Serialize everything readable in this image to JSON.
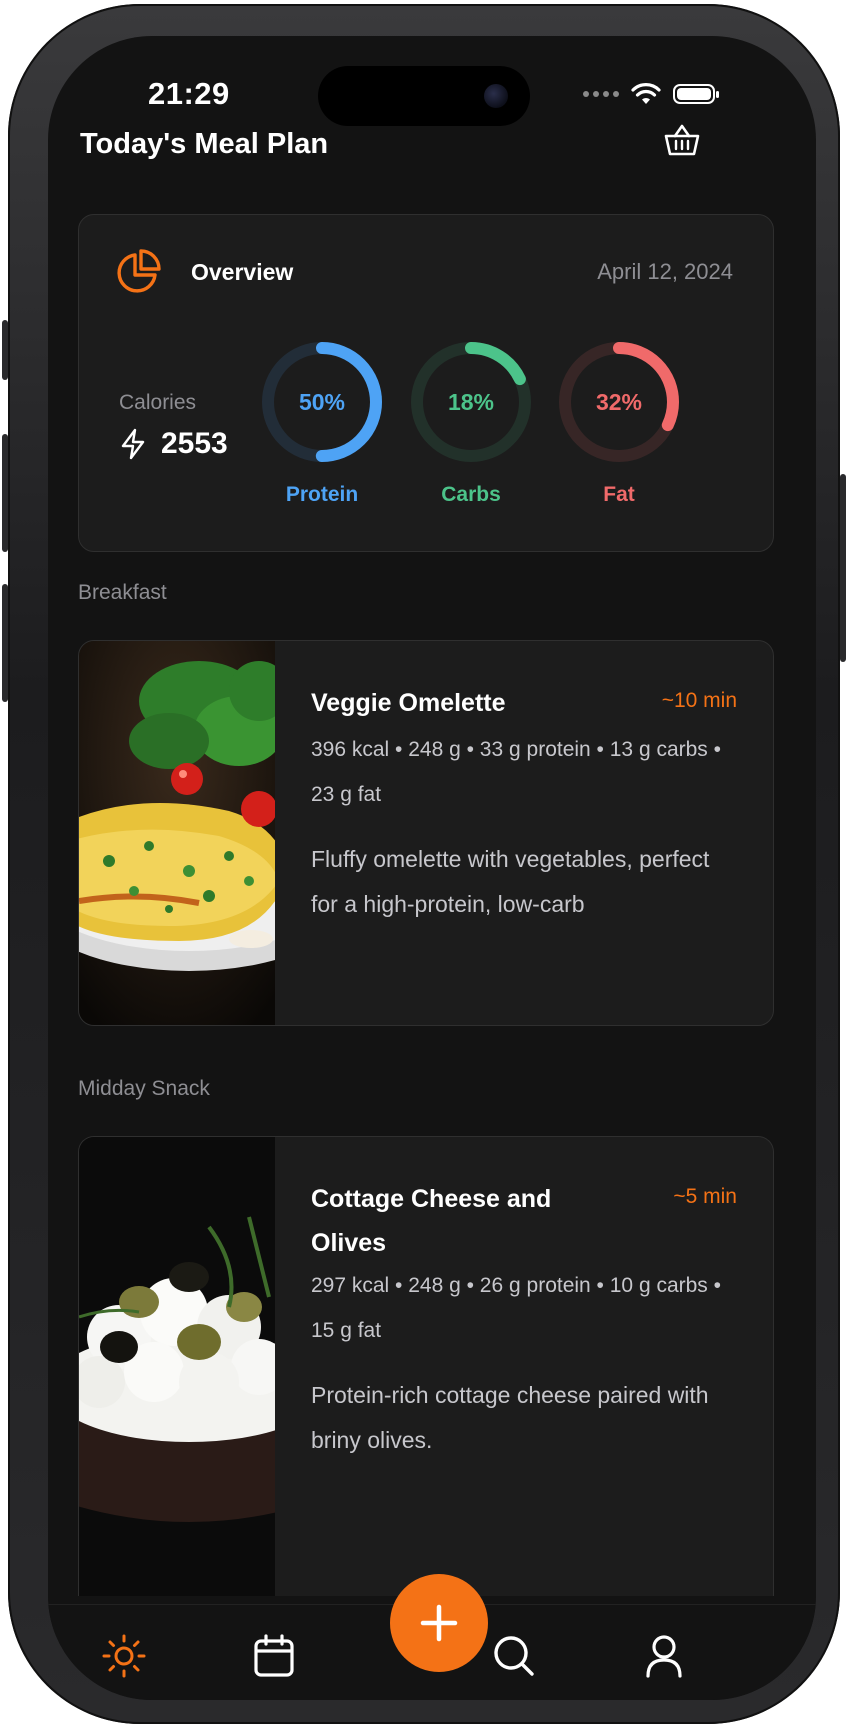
{
  "status": {
    "time": "21:29"
  },
  "header": {
    "title": "Today's Meal Plan",
    "icons": [
      "basket-icon"
    ]
  },
  "overview": {
    "title": "Overview",
    "date": "April 12, 2024",
    "calories_label": "Calories",
    "calories_value": "2553",
    "macros": [
      {
        "label": "Protein",
        "percent_text": "50%",
        "fraction": 0.5,
        "color": "#4ea3f5"
      },
      {
        "label": "Carbs",
        "percent_text": "18%",
        "fraction": 0.18,
        "color": "#4cc38a"
      },
      {
        "label": "Fat",
        "percent_text": "32%",
        "fraction": 0.32,
        "color": "#f06a6a"
      }
    ]
  },
  "sections": [
    {
      "title": "Breakfast",
      "meal": {
        "name": "Veggie Omelette",
        "time": "~10 min",
        "stats": "396 kcal • 248 g • 33 g protein • 13 g carbs • 23 g fat",
        "description": "Fluffy omelette with vegetables, perfect for a high-protein, low-carb"
      }
    },
    {
      "title": "Midday Snack",
      "meal": {
        "name": "Cottage Cheese and Olives",
        "time": "~5 min",
        "stats": "297 kcal • 248 g • 26 g protein • 10 g carbs • 15 g fat",
        "description": "Protein-rich cottage cheese paired with briny olives."
      }
    }
  ],
  "tabbar": {
    "tabs": [
      "sun-icon",
      "calendar-icon",
      "add-icon",
      "search-icon",
      "profile-icon"
    ],
    "active": "sun-icon",
    "accent": "#f47216"
  }
}
